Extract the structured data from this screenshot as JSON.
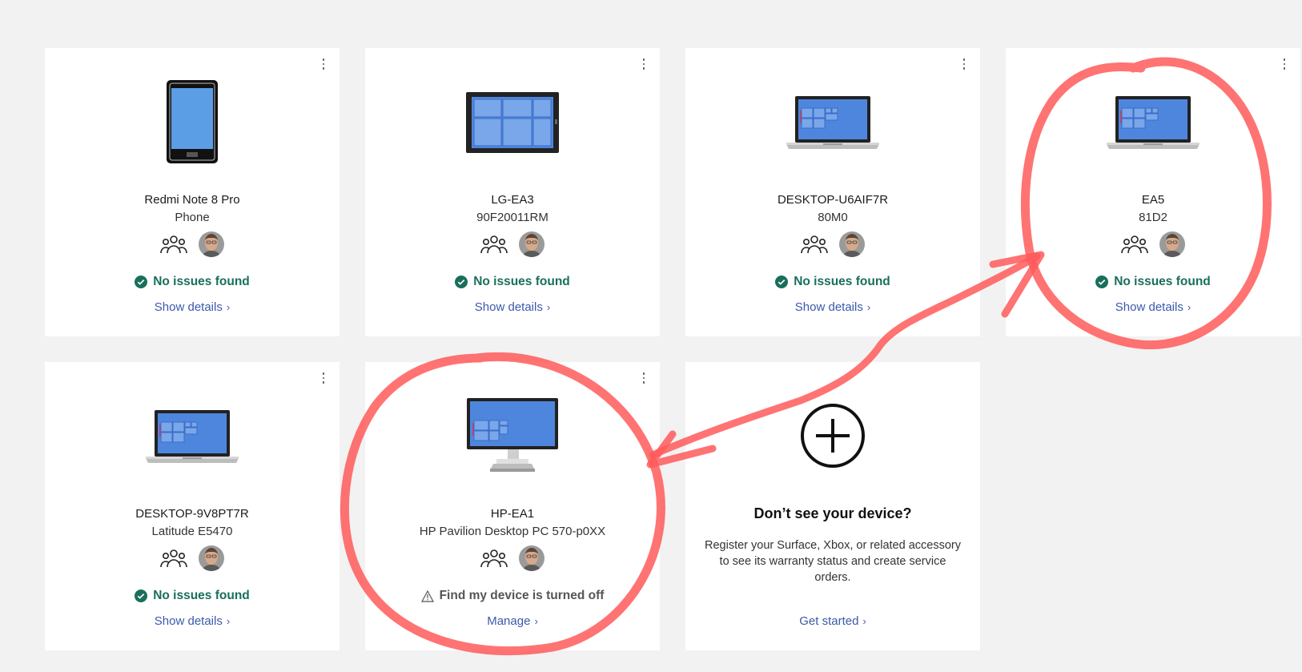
{
  "devices": [
    {
      "name": "Redmi Note 8 Pro",
      "model": "Phone",
      "icon": "phone-icon",
      "status": "No issues found",
      "status_type": "ok",
      "link": "Show details"
    },
    {
      "name": "LG-EA3",
      "model": "90F20011RM",
      "icon": "tablet-icon",
      "status": "No issues found",
      "status_type": "ok",
      "link": "Show details"
    },
    {
      "name": "DESKTOP-U6AIF7R",
      "model": "80M0",
      "icon": "laptop-icon",
      "status": "No issues found",
      "status_type": "ok",
      "link": "Show details"
    },
    {
      "name": "EA5",
      "model": "81D2",
      "icon": "laptop-icon",
      "status": "No issues found",
      "status_type": "ok",
      "link": "Show details"
    },
    {
      "name": "DESKTOP-9V8PT7R",
      "model": "Latitude E5470",
      "icon": "laptop-icon",
      "status": "No issues found",
      "status_type": "ok",
      "link": "Show details"
    },
    {
      "name": "HP-EA1",
      "model": "HP Pavilion Desktop PC 570-p0XX",
      "icon": "desktop-monitor-icon",
      "status": "Find my device is turned off",
      "status_type": "warning",
      "link": "Manage"
    }
  ],
  "add_device": {
    "title": "Don’t see your device?",
    "description": "Register your Surface, Xbox, or related accessory to see its warranty status and create service orders.",
    "link": "Get started",
    "icon": "plus-circle-icon"
  },
  "colors": {
    "ok_green": "#196f5b",
    "link_blue": "#3a5aa8",
    "annotation_red": "#ff5a5a",
    "screen_blue": "#4f86dd"
  }
}
